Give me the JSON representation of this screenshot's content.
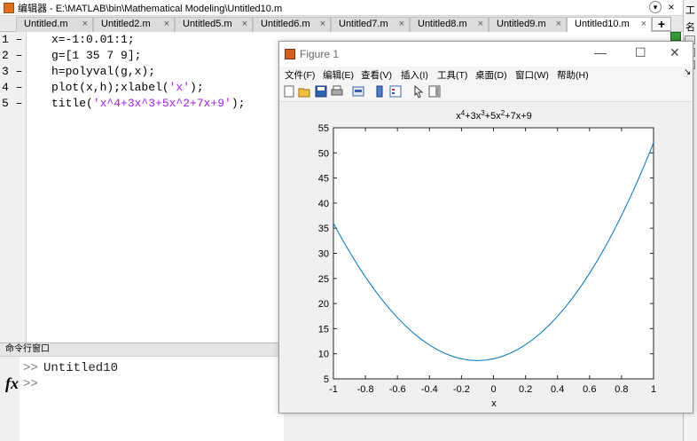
{
  "editor": {
    "title": "编辑器 - E:\\MATLAB\\bin\\Mathematical Modeling\\Untitled10.m",
    "tabs": [
      {
        "label": "Untitled.m"
      },
      {
        "label": "Untitled2.m"
      },
      {
        "label": "Untitled5.m"
      },
      {
        "label": "Untitled6.m"
      },
      {
        "label": "Untitled7.m"
      },
      {
        "label": "Untitled8.m"
      },
      {
        "label": "Untitled9.m"
      },
      {
        "label": "Untitled10.m",
        "active": true
      }
    ],
    "add_tab_label": "+",
    "line_numbers": [
      "1 –",
      "2 –",
      "3 –",
      "4 –",
      "5 –"
    ],
    "code": {
      "line1": "x=-1:0.01:1;",
      "line2": "g=[1 35 7 9];",
      "line3": "h=polyval(g,x);",
      "line4_pre": "plot(x,h);xlabel(",
      "line4_str": "'x'",
      "line4_post": ");",
      "line5_pre": "title(",
      "line5_str": "'x^4+3x^3+5x^2+7x+9'",
      "line5_post": ");"
    }
  },
  "right_panel": {
    "label1": "工",
    "label2": "名"
  },
  "command_window": {
    "title": "命令行窗口",
    "prompt": ">>",
    "history_command": "Untitled10",
    "fx_label": "fx"
  },
  "figure": {
    "title": "Figure 1",
    "menu": [
      "文件(F)",
      "编辑(E)",
      "查看(V)",
      "插入(I)",
      "工具(T)",
      "桌面(D)",
      "窗口(W)",
      "帮助(H)"
    ],
    "window_controls": {
      "minimize": "—",
      "maximize": "☐",
      "close": "✕"
    }
  },
  "chart_data": {
    "type": "line",
    "title_base": [
      "x",
      "+3x",
      "+5x",
      "+7x+9"
    ],
    "title_sup": [
      "4",
      "3",
      "2"
    ],
    "xlabel": "x",
    "ylabel": "",
    "xlim": [
      -1,
      1
    ],
    "ylim": [
      5,
      55
    ],
    "xticks": [
      -1,
      -0.8,
      -0.6,
      -0.4,
      -0.2,
      0,
      0.2,
      0.4,
      0.6,
      0.8,
      1
    ],
    "yticks": [
      5,
      10,
      15,
      20,
      25,
      30,
      35,
      40,
      45,
      50,
      55
    ],
    "polynomial_coefficients": [
      1,
      35,
      7,
      9
    ],
    "x_range": [
      -1,
      1,
      0.05
    ],
    "line_color": "#0072bd",
    "grid": false
  }
}
